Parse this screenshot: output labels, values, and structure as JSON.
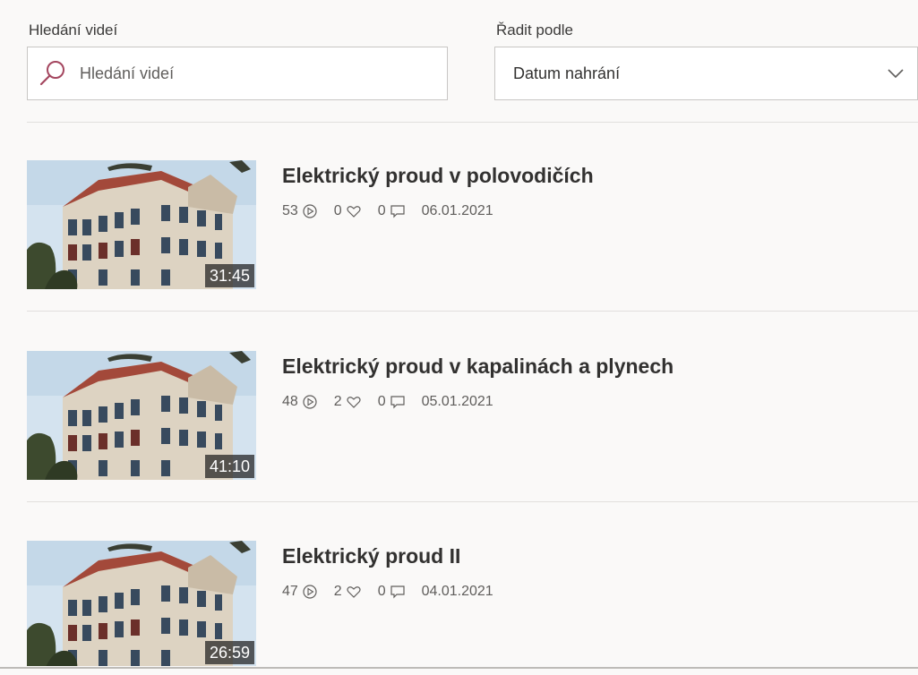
{
  "filters": {
    "search_label": "Hledání videí",
    "search_placeholder": "Hledání videí",
    "search_value": "",
    "sort_label": "Řadit podle",
    "sort_value": "Datum nahrání"
  },
  "videos": [
    {
      "title": "Elektrický proud v polovodičích",
      "duration": "31:45",
      "views": "53",
      "likes": "0",
      "comments": "0",
      "date": "06.01.2021"
    },
    {
      "title": "Elektrický proud v kapalinách a plynech",
      "duration": "41:10",
      "views": "48",
      "likes": "2",
      "comments": "0",
      "date": "05.01.2021"
    },
    {
      "title": "Elektrický proud II",
      "duration": "26:59",
      "views": "47",
      "likes": "2",
      "comments": "0",
      "date": "04.01.2021"
    }
  ],
  "icons": {
    "search": "search-icon",
    "sort": "chevron-down-icon",
    "views": "play-circle-icon",
    "likes": "heart-icon",
    "comments": "comment-icon"
  },
  "colors": {
    "background": "#faf9f8",
    "search_icon": "#a4465f",
    "text_primary": "#323130",
    "text_secondary": "#605e5c",
    "border": "#c8c6c4"
  }
}
